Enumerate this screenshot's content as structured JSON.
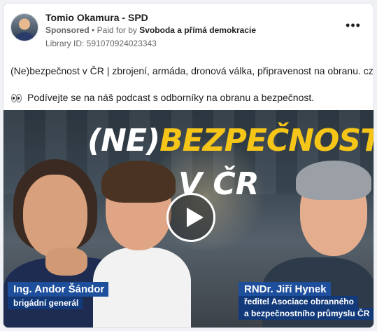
{
  "post": {
    "page_name": "Tomio Okamura - SPD",
    "sponsored": "Sponsored",
    "separator": "•",
    "paid_for_prefix": "Paid for by",
    "payer": "Svoboda a přímá demokracie",
    "library_id": "Library ID: 591070924023343",
    "more_label": "•••",
    "text_line1": "(Ne)bezpečnost v ČR | zbrojení, armáda, dronová válka, připravenost na obranu. cz",
    "text_line2": "Podívejte se na náš podcast s odborníky na obranu a bezpečnost."
  },
  "media": {
    "headline_ne": "(NE)",
    "headline_rest": "BEZPEČNOST",
    "headline_line2": "V ČR",
    "left_person_name": "Ing. Andor Šándor",
    "left_person_title": "brigádní generál",
    "right_person_name": "RNDr. Jiří Hynek",
    "right_person_title1": "ředitel Asociace obranného",
    "right_person_title2": "a bezpečnostního průmyslu ČR",
    "icons": [
      "play-icon",
      "eyes-emoji-icon",
      "more-icon"
    ],
    "colors": {
      "headline_yellow": "#f5c518",
      "tag_blue": "#1e4f9c"
    }
  }
}
